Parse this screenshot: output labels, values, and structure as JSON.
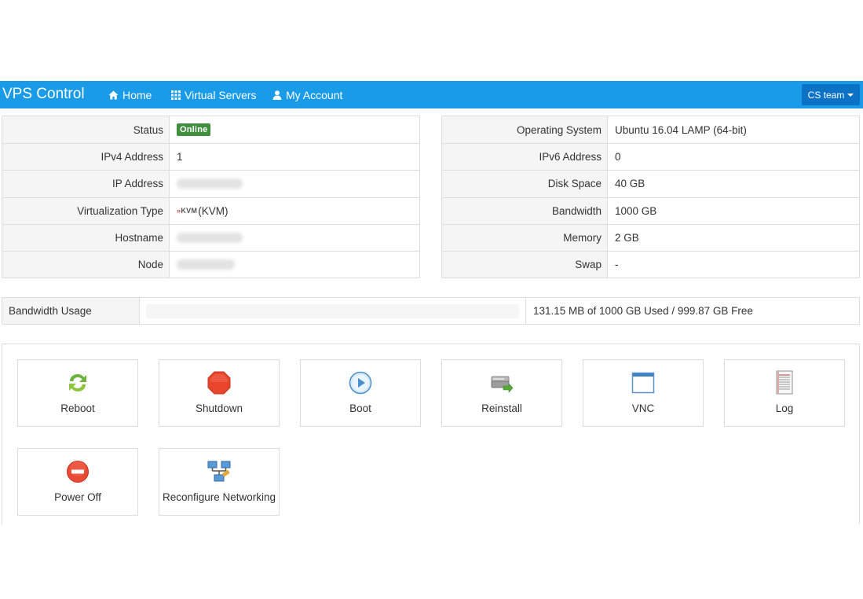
{
  "navbar": {
    "brand": "VPS Control",
    "items": [
      {
        "label": "Home",
        "icon": "home-icon"
      },
      {
        "label": "Virtual Servers",
        "icon": "grid-icon"
      },
      {
        "label": "My Account",
        "icon": "user-icon"
      }
    ],
    "team_button": "CS team",
    "color": "#1a9be8"
  },
  "info_left": [
    {
      "label": "Status",
      "value": "Online"
    },
    {
      "label": "IPv4 Address",
      "value": "1"
    },
    {
      "label": "IP Address",
      "value": ""
    },
    {
      "label": "Virtualization Type",
      "logo": "KVM",
      "value": "(KVM)"
    },
    {
      "label": "Hostname",
      "value": ""
    },
    {
      "label": "Node",
      "value": ""
    }
  ],
  "info_right": [
    {
      "label": "Operating System",
      "value": "Ubuntu 16.04 LAMP (64-bit)"
    },
    {
      "label": "IPv6 Address",
      "value": "0"
    },
    {
      "label": "Disk Space",
      "value": "40 GB"
    },
    {
      "label": "Bandwidth",
      "value": "1000 GB"
    },
    {
      "label": "Memory",
      "value": "2 GB"
    },
    {
      "label": "Swap",
      "value": "-"
    }
  ],
  "bandwidth_usage": {
    "label": "Bandwidth Usage",
    "used_fraction": 0.0001,
    "summary": "131.15 MB of 1000 GB Used / 999.87 GB Free"
  },
  "actions": [
    {
      "label": "Reboot",
      "icon": "reboot-icon"
    },
    {
      "label": "Shutdown",
      "icon": "shutdown-icon"
    },
    {
      "label": "Boot",
      "icon": "boot-icon"
    },
    {
      "label": "Reinstall",
      "icon": "reinstall-icon"
    },
    {
      "label": "VNC",
      "icon": "vnc-icon"
    },
    {
      "label": "Log",
      "icon": "log-icon"
    },
    {
      "label": "Power Off",
      "icon": "power-off-icon"
    },
    {
      "label": "Reconfigure Networking",
      "icon": "network-icon"
    }
  ],
  "colors": {
    "online_badge": "#3f8f3f",
    "accent": "#1a9be8",
    "team_button": "#0b72c6"
  }
}
